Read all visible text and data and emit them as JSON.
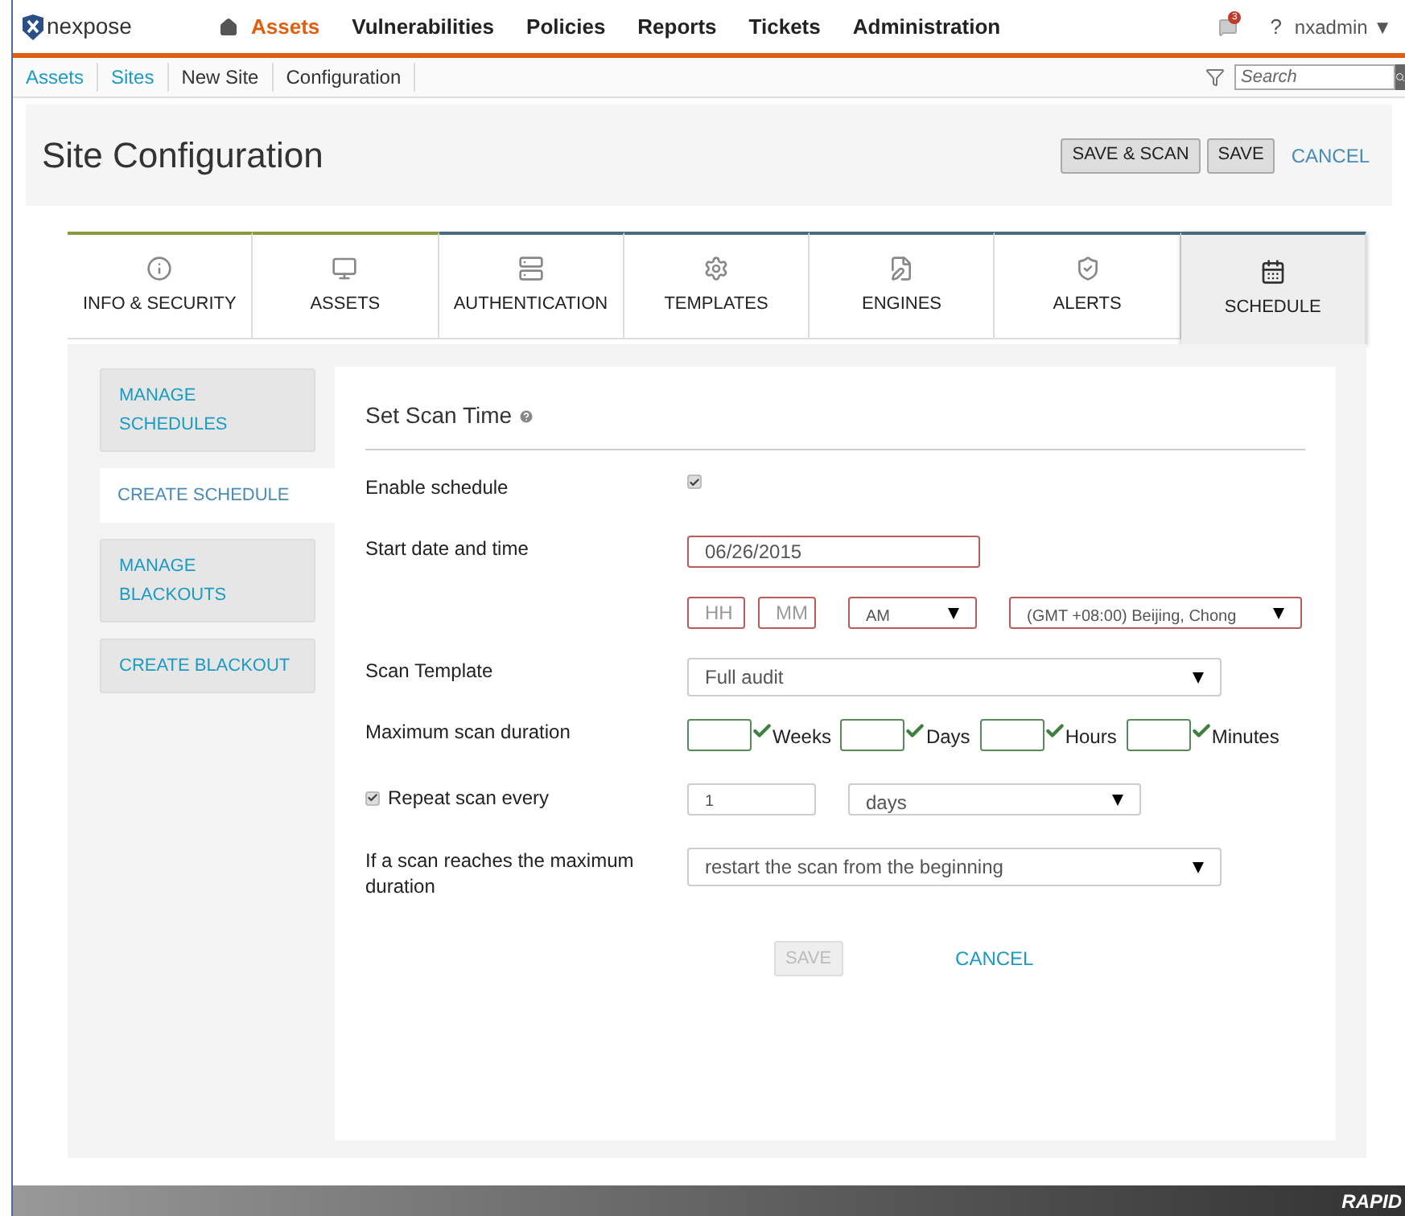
{
  "topnav": {
    "brand": "nexpose",
    "items": [
      {
        "label": "Assets",
        "selected": true
      },
      {
        "label": "Vulnerabilities",
        "selected": false
      },
      {
        "label": "Policies",
        "selected": false
      },
      {
        "label": "Reports",
        "selected": false
      },
      {
        "label": "Tickets",
        "selected": false
      },
      {
        "label": "Administration",
        "selected": false
      }
    ],
    "notifications": "3",
    "help": "?",
    "user": "nxadmin ▼"
  },
  "breadcrumb": [
    {
      "label": "Assets",
      "link": true
    },
    {
      "label": "Sites",
      "link": true
    },
    {
      "label": "New Site",
      "link": false
    },
    {
      "label": "Configuration",
      "link": false
    }
  ],
  "search": {
    "placeholder": "Search"
  },
  "header": {
    "title": "Site Configuration",
    "buttons": [
      "SAVE & SCAN",
      "SAVE"
    ],
    "cancel": "CANCEL"
  },
  "tabs": [
    {
      "label": "INFO & SECURITY",
      "selected": false,
      "done": true
    },
    {
      "label": "ASSETS",
      "selected": false,
      "done": true
    },
    {
      "label": "AUTHENTICATION",
      "selected": false,
      "done": false
    },
    {
      "label": "TEMPLATES",
      "selected": false,
      "done": false
    },
    {
      "label": "ENGINES",
      "selected": false,
      "done": false
    },
    {
      "label": "ALERTS",
      "selected": false,
      "done": false
    },
    {
      "label": "SCHEDULE",
      "selected": true,
      "done": false
    }
  ],
  "sidebar": {
    "items": [
      {
        "label": "MANAGE SCHEDULES",
        "selected": false
      },
      {
        "label": "CREATE SCHEDULE",
        "selected": true
      },
      {
        "label": "MANAGE BLACKOUTS",
        "selected": false
      },
      {
        "label": "CREATE BLACKOUT",
        "selected": false
      }
    ]
  },
  "form": {
    "title": "Set Scan Time",
    "fields": [
      {
        "kind": "checkbox",
        "label": "Enable schedule",
        "checked": true
      },
      {
        "kind": "date",
        "label": "Start date and time",
        "value": "06/26/2015"
      },
      {
        "kind": "time",
        "hour_placeholder": "HH",
        "minute_placeholder": "MM",
        "meridiem": "AM",
        "timezone": "(GMT +08:00) Beijing, Chong"
      },
      {
        "kind": "select",
        "label": "Scan Template",
        "value": "Full audit"
      },
      {
        "kind": "duration",
        "label": "Maximum scan duration",
        "units": [
          "Weeks",
          "Days",
          "Hours",
          "Minutes"
        ]
      },
      {
        "kind": "repeat",
        "label": "Repeat scan every",
        "checked": true,
        "value": "1",
        "unit": "days"
      },
      {
        "kind": "select",
        "label": "If a scan reaches the maximum duration",
        "value": "restart the scan from the beginning"
      }
    ],
    "save": {
      "label": "SAVE",
      "disabled": true
    },
    "cancel": "CANCEL"
  },
  "footer": {
    "brand": "RAPID"
  }
}
